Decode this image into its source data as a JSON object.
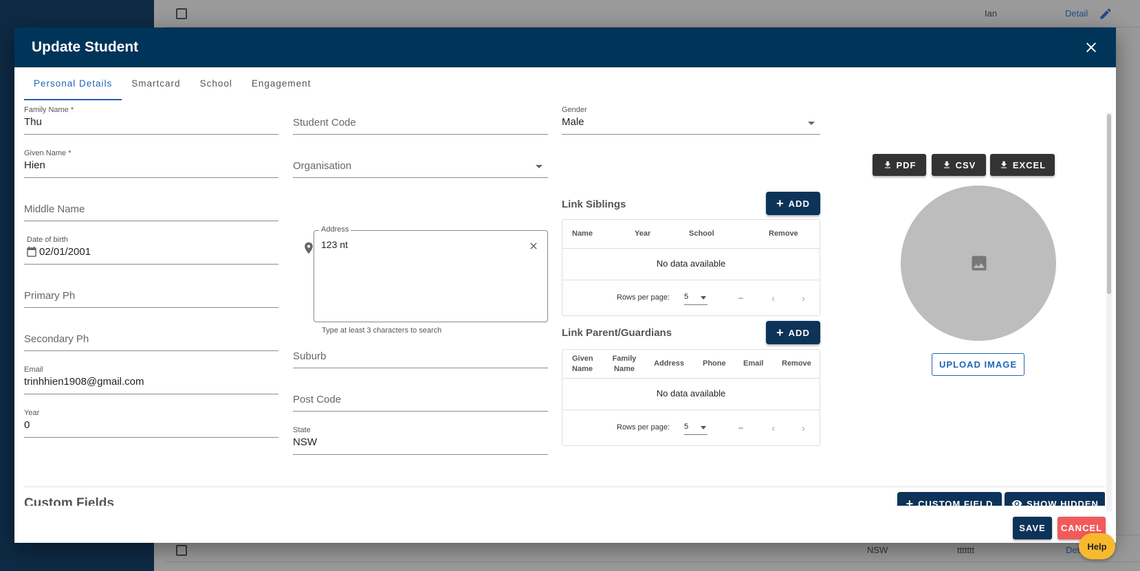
{
  "background": {
    "rows": [
      {
        "col_a": "",
        "col_b": "Ian",
        "link": "Detail"
      },
      {
        "col_a": "NSW",
        "col_b": "ttttttt",
        "link": "Det"
      }
    ]
  },
  "dialog": {
    "title": "Update Student",
    "tabs": [
      {
        "label": "Personal Details",
        "active": true
      },
      {
        "label": "Smartcard"
      },
      {
        "label": "School"
      },
      {
        "label": "Engagement"
      }
    ]
  },
  "form": {
    "family_name": {
      "label": "Family Name *",
      "value": "Thu"
    },
    "given_name": {
      "label": "Given Name *",
      "value": "Hien"
    },
    "middle_name": {
      "placeholder": "Middle Name"
    },
    "dob": {
      "label": "Date of birth",
      "value": "02/01/2001"
    },
    "primary_ph": {
      "placeholder": "Primary Ph"
    },
    "secondary_ph": {
      "placeholder": "Secondary Ph"
    },
    "email": {
      "label": "Email",
      "value": "trinhhien1908@gmail.com"
    },
    "year": {
      "label": "Year",
      "value": "0"
    },
    "student_code": {
      "placeholder": "Student Code"
    },
    "organisation": {
      "placeholder": "Organisation"
    },
    "address": {
      "label": "Address",
      "value": "123 nt",
      "hint": "Type at least 3 characters to search"
    },
    "suburb": {
      "placeholder": "Suburb"
    },
    "post_code": {
      "placeholder": "Post Code"
    },
    "state": {
      "label": "State",
      "value": "NSW"
    },
    "gender": {
      "label": "Gender",
      "value": "Male"
    }
  },
  "siblings": {
    "title": "Link Siblings",
    "add_label": "ADD",
    "columns": [
      "Name",
      "Year",
      "School",
      "Remove"
    ],
    "empty": "No data available",
    "rows_per_page_label": "Rows per page:",
    "rows_per_page": "5",
    "range": "–"
  },
  "guardians": {
    "title": "Link Parent/Guardians",
    "add_label": "ADD",
    "columns": [
      "Given Name",
      "Family Name",
      "Address",
      "Phone",
      "Email",
      "Remove"
    ],
    "empty": "No data available",
    "rows_per_page_label": "Rows per page:",
    "rows_per_page": "5",
    "range": "–"
  },
  "export": {
    "pdf": "PDF",
    "csv": "CSV",
    "excel": "EXCEL"
  },
  "photo": {
    "upload_label": "UPLOAD IMAGE"
  },
  "custom_fields": {
    "title": "Custom Fields",
    "add_label": "CUSTOM FIELD",
    "show_hidden_label": "SHOW HIDDEN"
  },
  "footer": {
    "save": "SAVE",
    "cancel": "CANCEL",
    "help": "Help"
  },
  "colors": {
    "header": "#003459",
    "primary": "#0d3358",
    "cancel": "#f25a5a",
    "help": "#f8b92e",
    "tab_active": "#1f64b4"
  }
}
